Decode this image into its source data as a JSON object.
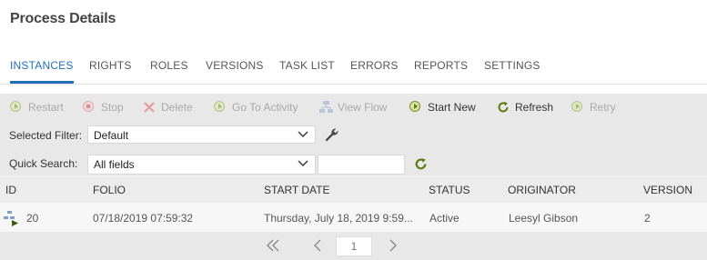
{
  "page": {
    "title": "Process Details"
  },
  "tabs": [
    {
      "label": "INSTANCES"
    },
    {
      "label": "RIGHTS"
    },
    {
      "label": "ROLES"
    },
    {
      "label": "VERSIONS"
    },
    {
      "label": "TASK LIST"
    },
    {
      "label": "ERRORS"
    },
    {
      "label": "REPORTS"
    },
    {
      "label": "SETTINGS"
    }
  ],
  "toolbar": {
    "restart": "Restart",
    "stop": "Stop",
    "delete": "Delete",
    "goto": "Go To Activity",
    "viewflow": "View Flow",
    "startnew": "Start New",
    "refresh": "Refresh",
    "retry": "Retry"
  },
  "filter": {
    "label": "Selected Filter:",
    "value": "Default"
  },
  "search": {
    "label": "Quick Search:",
    "scope": "All fields",
    "value": ""
  },
  "table": {
    "headers": {
      "id": "ID",
      "folio": "FOLIO",
      "start": "START DATE",
      "status": "STATUS",
      "originator": "ORIGINATOR",
      "version": "VERSION"
    },
    "rows": [
      {
        "id": "20",
        "folio": "07/18/2019 07:59:32",
        "start": "Thursday, July 18, 2019 9:59...",
        "status": "Active",
        "originator": "Leesyl Gibson",
        "version": "2"
      }
    ]
  },
  "pager": {
    "page": "1"
  },
  "colors": {
    "accent": "#1f6fb5",
    "panel": "#e8e8e8",
    "refresh": "#5e7a10"
  }
}
